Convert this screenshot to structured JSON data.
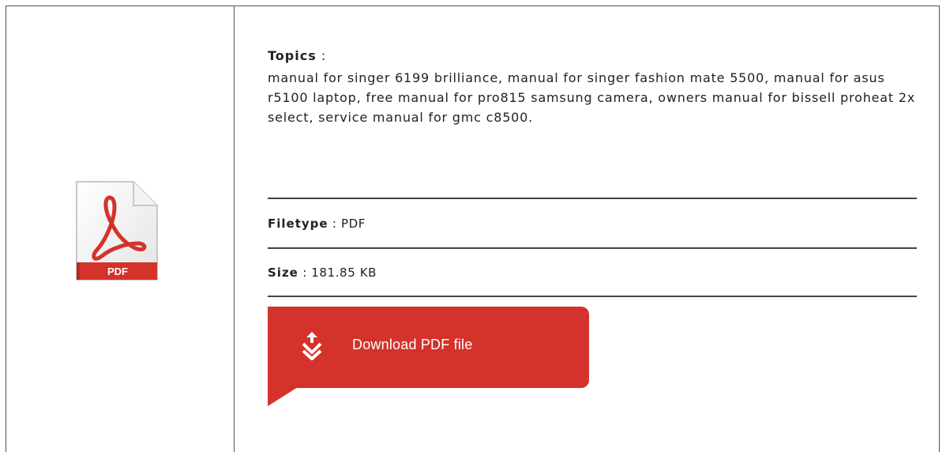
{
  "icon": {
    "name": "pdf-file-icon",
    "label": "PDF",
    "accent": "#d3332a"
  },
  "topics": {
    "heading": "Topics",
    "separator": " :",
    "text": "manual for singer 6199 brilliance, manual for singer fashion mate 5500, manual for asus r5100 laptop, free manual for pro815 samsung camera, owners manual for bissell proheat 2x select, service manual for gmc c8500."
  },
  "filetype": {
    "heading": "Filetype",
    "separator": " : ",
    "value": "PDF"
  },
  "size": {
    "heading": "Size",
    "separator": " : ",
    "value": "181.85 KB"
  },
  "download": {
    "label": "Download PDF file",
    "color": "#d3332a",
    "icon": "download-arrow-icon"
  }
}
